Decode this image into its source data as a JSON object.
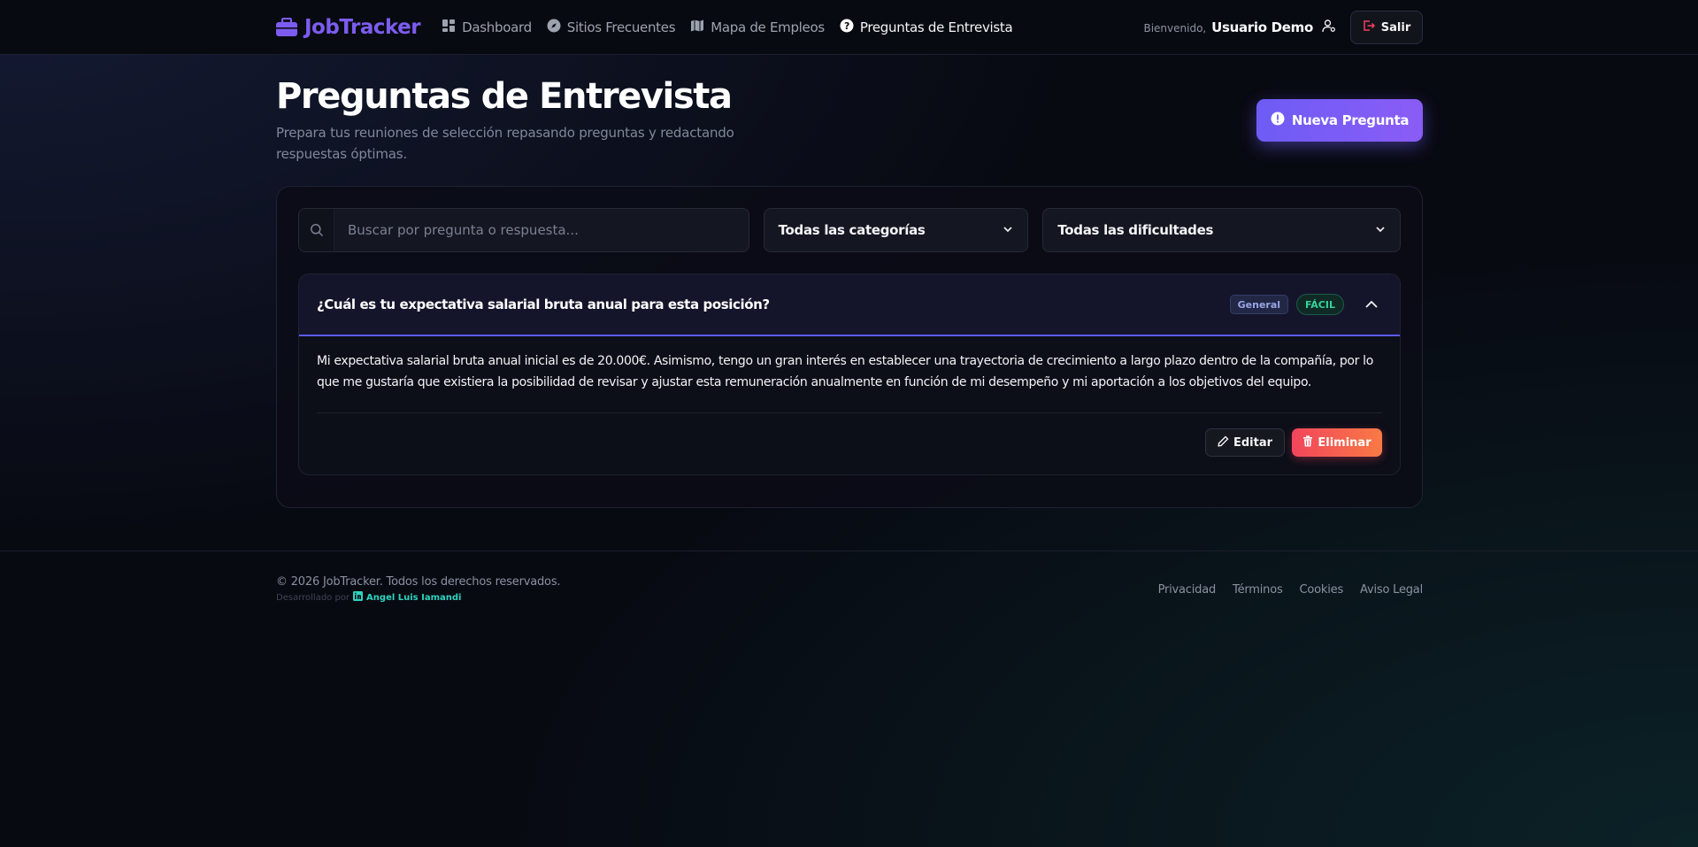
{
  "app": {
    "brand": "JobTracker",
    "brand_color": "#7c5cf0",
    "accent": "#6d5cf5"
  },
  "nav": {
    "items": [
      {
        "label": "Dashboard",
        "icon": "dashboard-icon"
      },
      {
        "label": "Sitios Frecuentes",
        "icon": "compass-icon"
      },
      {
        "label": "Mapa de Empleos",
        "icon": "map-icon"
      },
      {
        "label": "Preguntas de Entrevista",
        "icon": "question-circle-icon",
        "active": true
      }
    ],
    "welcome_prefix": "Bienvenido,",
    "user_name": "Usuario Demo",
    "logout_label": "Salir"
  },
  "header": {
    "title": "Preguntas de Entrevista",
    "subtitle": "Prepara tus reuniones de selección repasando preguntas y redactando respuestas óptimas.",
    "new_button_label": "Nueva Pregunta"
  },
  "filters": {
    "search_placeholder": "Buscar por pregunta o respuesta...",
    "search_value": "",
    "category_selected": "Todas las categorías",
    "difficulty_selected": "Todas las dificultades"
  },
  "questions": [
    {
      "question": "¿Cuál es tu expectativa salarial bruta anual para esta posición?",
      "category": "General",
      "difficulty": "FÁCIL",
      "expanded": true,
      "answer": "Mi expectativa salarial bruta anual inicial es de 20.000€. Asimismo, tengo un gran interés en establecer una trayectoria de crecimiento a largo plazo dentro de la compañía, por lo que me gustaría que existiera la posibilidad de revisar y ajustar esta remuneración anualmente en función de mi desempeño y mi aportación a los objetivos del equipo.",
      "edit_label": "Editar",
      "delete_label": "Eliminar"
    }
  ],
  "footer": {
    "copyright": "© 2026 JobTracker. Todos los derechos reservados.",
    "developed_by": "Desarrollado por",
    "developer_name": "Angel Luis Iamandi",
    "links": [
      "Privacidad",
      "Términos",
      "Cookies",
      "Aviso Legal"
    ]
  }
}
